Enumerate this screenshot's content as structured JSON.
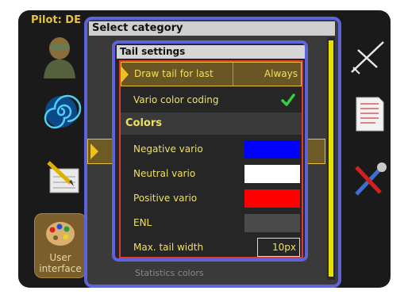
{
  "pilot": {
    "label": "Pilot: DE"
  },
  "sidebar": {
    "ui_button_label": "User interface"
  },
  "category_dialog": {
    "title": "Select category",
    "bottom_item": "Statistics colors"
  },
  "tail_dialog": {
    "title": "Tail settings",
    "draw_tail": {
      "label": "Draw tail for last",
      "value": "Always"
    },
    "vario_color": {
      "label": "Vario color coding",
      "checked": true
    },
    "colors_header": "Colors",
    "negative": {
      "label": "Negative vario",
      "color": "#0000ff"
    },
    "neutral": {
      "label": "Neutral vario",
      "color": "#ffffff"
    },
    "positive": {
      "label": "Positive vario",
      "color": "#ff0000"
    },
    "enl": {
      "label": "ENL",
      "color": "#4a4a4a"
    },
    "max_width": {
      "label": "Max. tail width",
      "value": "10px"
    }
  },
  "colors": {
    "accent_yellow": "#f0e060",
    "dialog_border": "#5f63d9",
    "focus_border": "#e23b2b",
    "selection_gold": "#e8c040"
  },
  "icons": [
    "pilot-icon",
    "spiral-icon",
    "notepad-icon",
    "palette-icon",
    "glider-icon",
    "document-icon",
    "tools-icon",
    "checkmark-icon"
  ]
}
